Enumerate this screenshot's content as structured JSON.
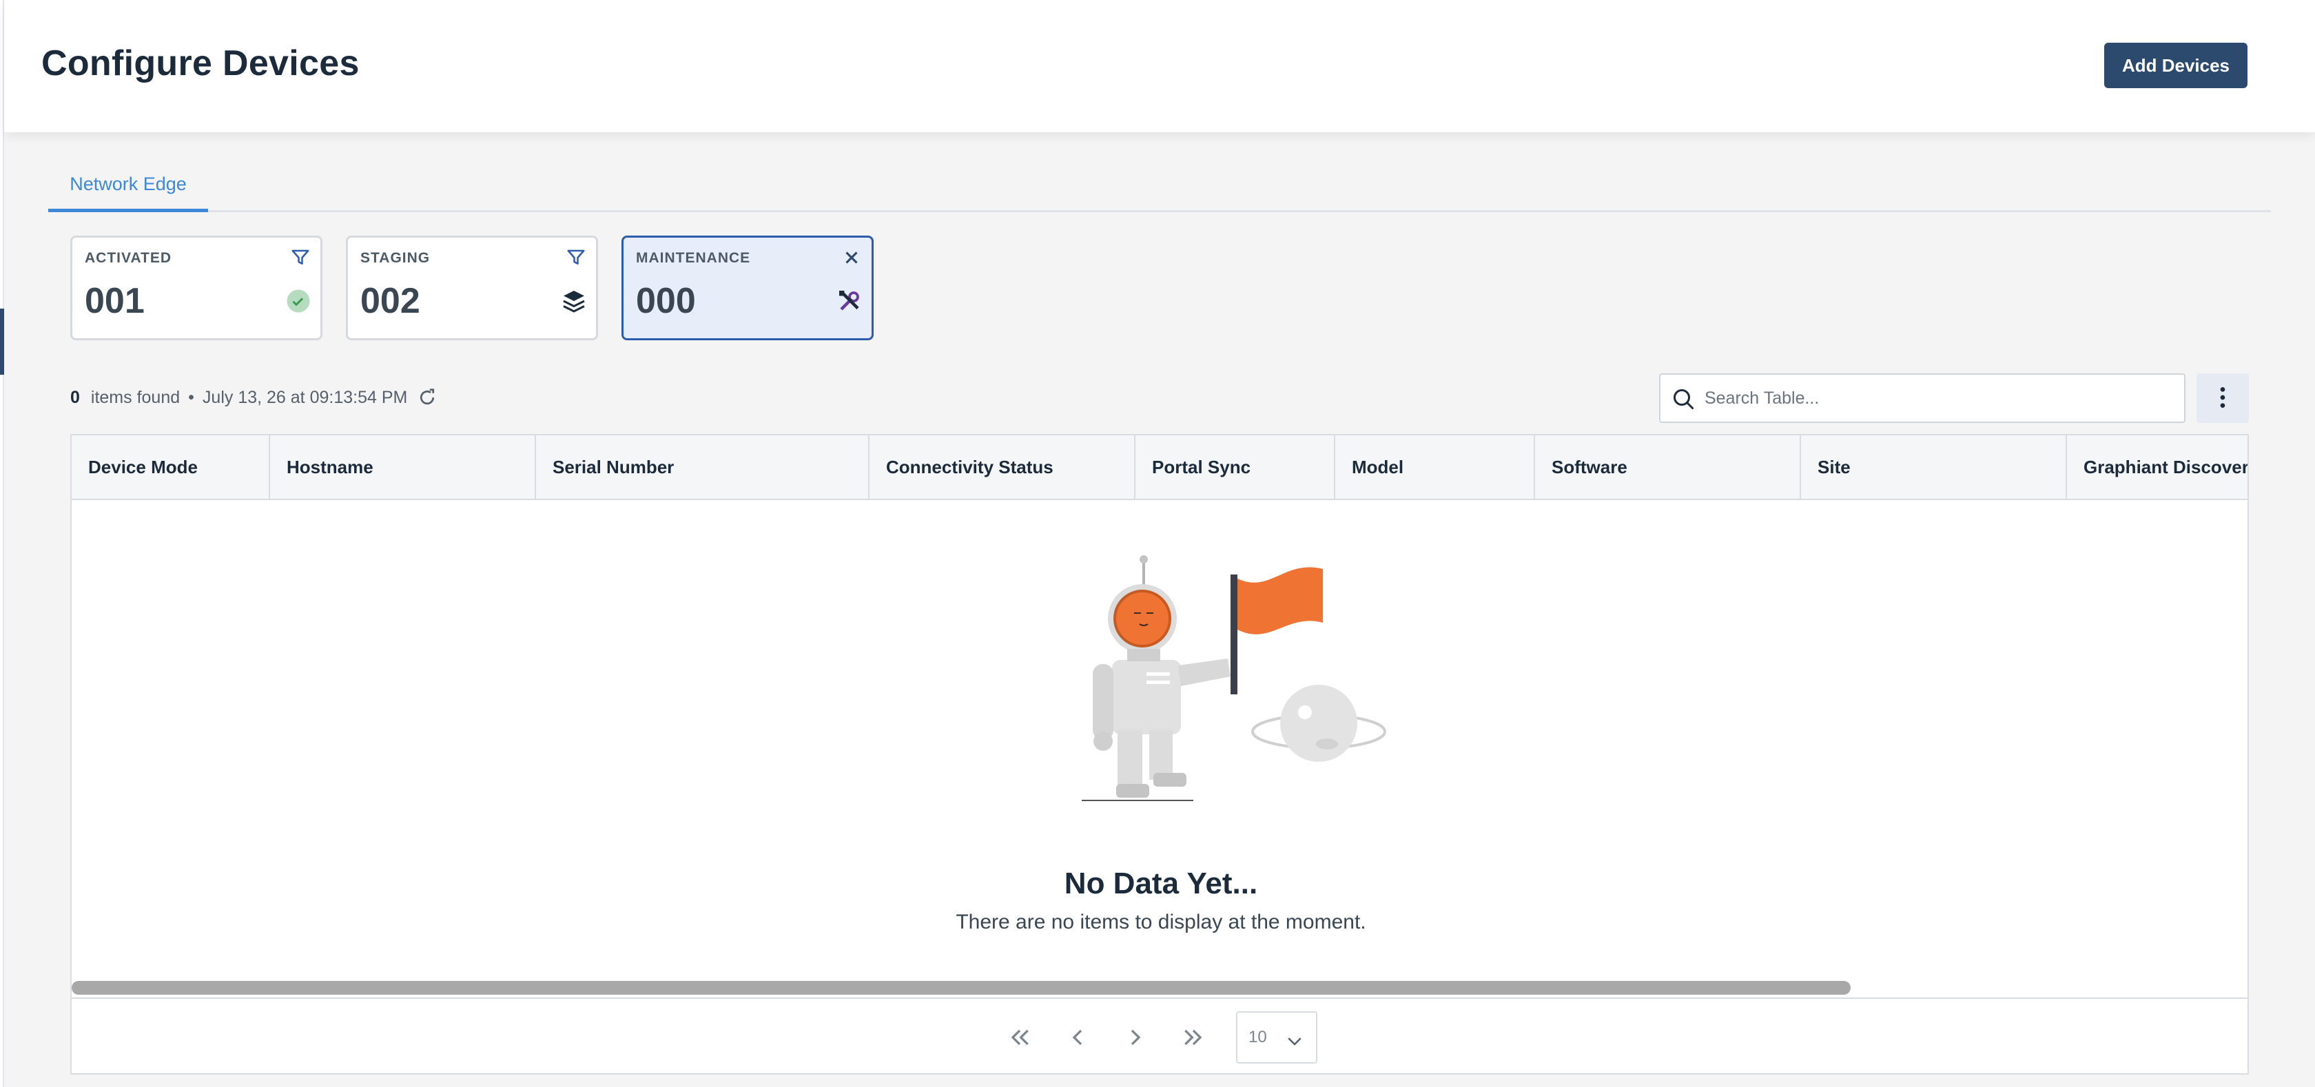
{
  "page": {
    "title": "Configure Devices",
    "add_button": "Add Devices"
  },
  "tabs": [
    {
      "label": "Network Edge",
      "active": true
    }
  ],
  "status_cards": [
    {
      "label": "ACTIVATED",
      "value": "001",
      "corner_icon": "filter-icon",
      "icon": "check-circle-icon",
      "selected": false
    },
    {
      "label": "STAGING",
      "value": "002",
      "corner_icon": "filter-icon",
      "icon": "layers-icon",
      "selected": false
    },
    {
      "label": "MAINTENANCE",
      "value": "000",
      "corner_icon": "close-icon",
      "icon": "tools-icon",
      "selected": true
    }
  ],
  "summary": {
    "count": "0",
    "count_label": "items found",
    "separator": "•",
    "timestamp": "July 13, 26 at 09:13:54 PM"
  },
  "search": {
    "placeholder": "Search Table..."
  },
  "table": {
    "columns": [
      "Device Mode",
      "Hostname",
      "Serial Number",
      "Connectivity Status",
      "Portal Sync",
      "Model",
      "Software",
      "Site",
      "Graphiant Discovered"
    ],
    "rows": []
  },
  "empty_state": {
    "title": "No Data Yet...",
    "message": "There are no items to display at the moment."
  },
  "pagination": {
    "page_size": "10"
  },
  "colors": {
    "primary": "#2c4a6e",
    "tab_active": "#3d88d9",
    "selected_card_bg": "#e8eef9",
    "flag": "#ef7434"
  }
}
